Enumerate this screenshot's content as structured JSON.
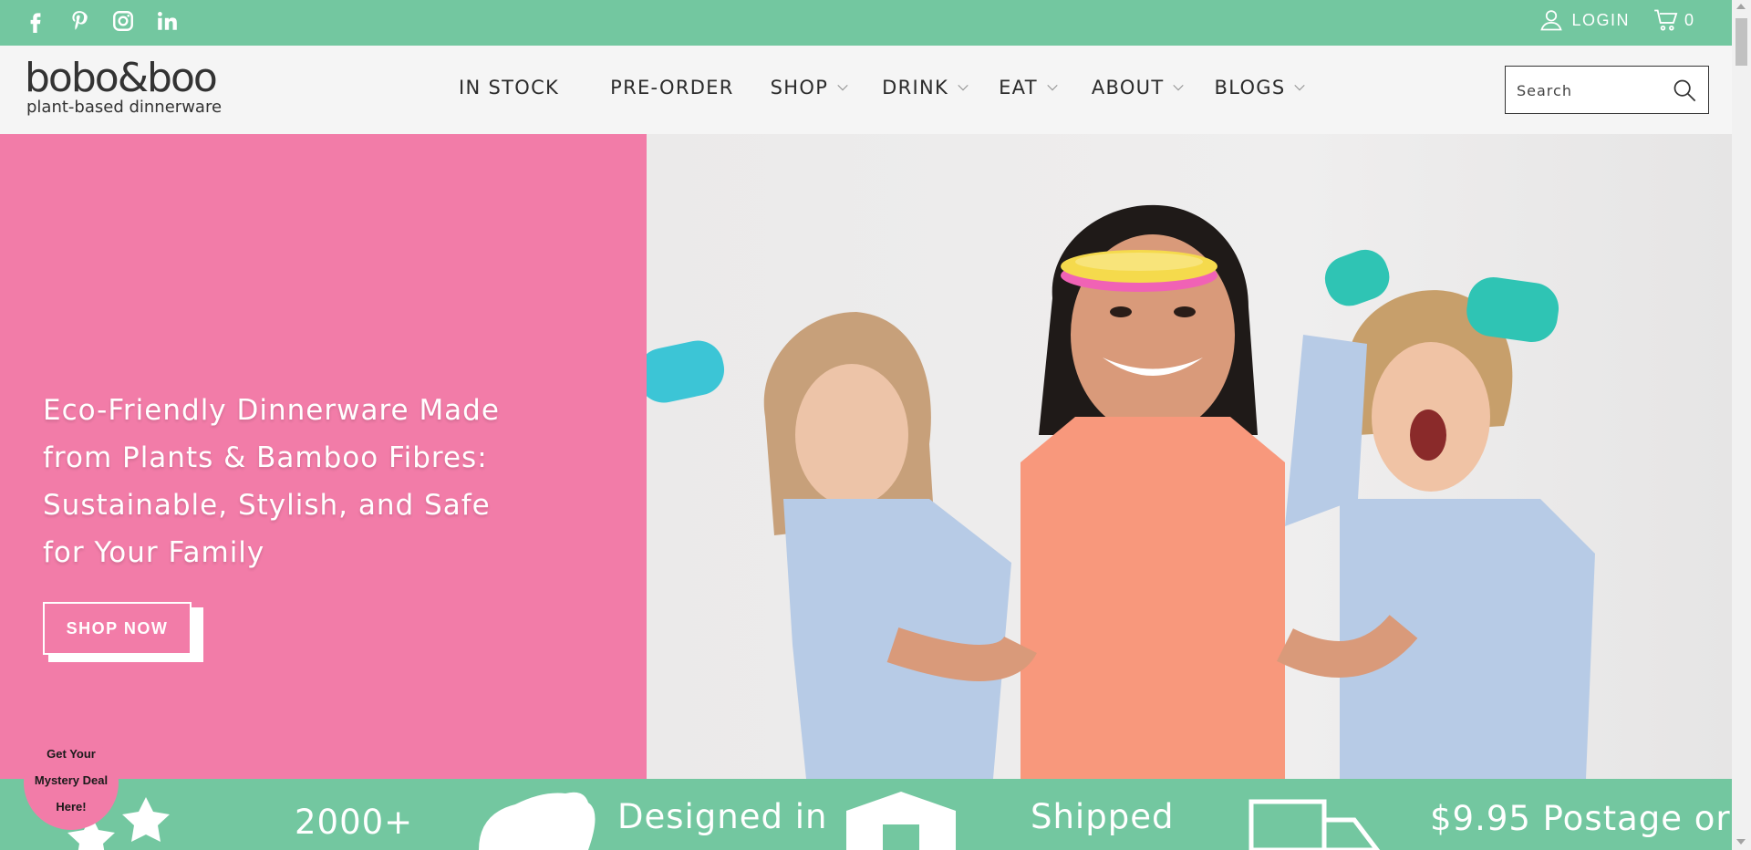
{
  "topbar": {
    "social_icons": [
      "facebook-icon",
      "pinterest-icon",
      "instagram-icon",
      "linkedin-icon"
    ],
    "login_label": "LOGIN",
    "cart_count": "0"
  },
  "header": {
    "logo_main": "bobo&boo",
    "logo_sub": "plant-based dinnerware",
    "nav": [
      {
        "label": "IN STOCK",
        "dropdown": false
      },
      {
        "label": "PRE-ORDER",
        "dropdown": false
      },
      {
        "label": "SHOP",
        "dropdown": true
      },
      {
        "label": "DRINK",
        "dropdown": true
      },
      {
        "label": "EAT",
        "dropdown": true
      },
      {
        "label": "ABOUT",
        "dropdown": true
      },
      {
        "label": "BLOGS",
        "dropdown": true
      }
    ],
    "search_placeholder": "Search"
  },
  "hero": {
    "title": "Eco-Friendly Dinnerware Made from Plants & Bamboo Fibres: Sustainable, Stylish, and Safe for Your Family",
    "button_label": "SHOP NOW"
  },
  "stats": {
    "items": [
      "2000+",
      "Designed in",
      "Shipped",
      "$9.95 Postage or"
    ]
  },
  "mystery": {
    "line1": "Get Your",
    "line2": "Mystery Deal",
    "line3": "Here!"
  },
  "colors": {
    "green": "#73c7a0",
    "pink": "#f27ca8",
    "header_bg": "#f5f5f5"
  }
}
